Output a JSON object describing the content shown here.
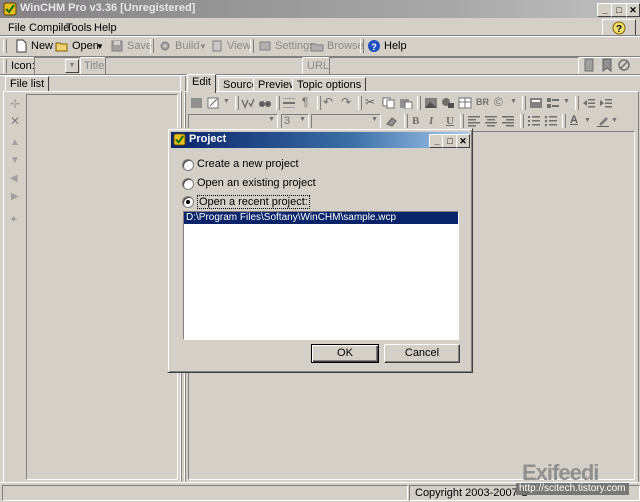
{
  "window": {
    "title": "WinCHM Pro v3.36 [Unregistered]",
    "controls": {
      "minimize": "_",
      "maximize": "□",
      "close": "✕"
    }
  },
  "menu": {
    "items": [
      "File",
      "Compile",
      "Tools",
      "Help"
    ]
  },
  "toolbar": {
    "new_label": "New",
    "open_label": "Open",
    "save_label": "Save",
    "build_label": "Build",
    "view_label": "View",
    "settings_label": "Settings",
    "browse_label": "Browse",
    "help_label": "Help"
  },
  "fields": {
    "icon_label": "Icon:",
    "title_label": "Title:",
    "url_label": "URL:"
  },
  "left_panel": {
    "tab_label": "File list"
  },
  "editor": {
    "tabs": [
      "Edit",
      "Source",
      "Preview",
      "Topic options"
    ],
    "active_tab": "Edit",
    "font_size_value": "3",
    "format_bold": "B",
    "format_italic": "I",
    "format_underline": "U",
    "format_br": "BR",
    "font_color_letter": "A"
  },
  "dialog": {
    "title": "Project",
    "controls": {
      "minimize": "_",
      "maximize": "□",
      "close": "✕"
    },
    "options": [
      {
        "label": "Create a new project",
        "selected": false
      },
      {
        "label": "Open an existing project",
        "selected": false
      },
      {
        "label": "Open a recent project:",
        "selected": true
      }
    ],
    "recent_projects": [
      "D:\\Program Files\\Softany\\WinCHM\\sample.wcp"
    ],
    "ok_label": "OK",
    "cancel_label": "Cancel"
  },
  "status_bar": {
    "copyright": "Copyright 2003-2007 S"
  },
  "watermark": {
    "brand": "Exifeedi",
    "url": "http://scitech.tistory.com"
  },
  "colors": {
    "dialog_title_start": "#0a246a",
    "dialog_title_end": "#a6caf0",
    "selection": "#0a246a",
    "face": "#d4d0c8"
  }
}
